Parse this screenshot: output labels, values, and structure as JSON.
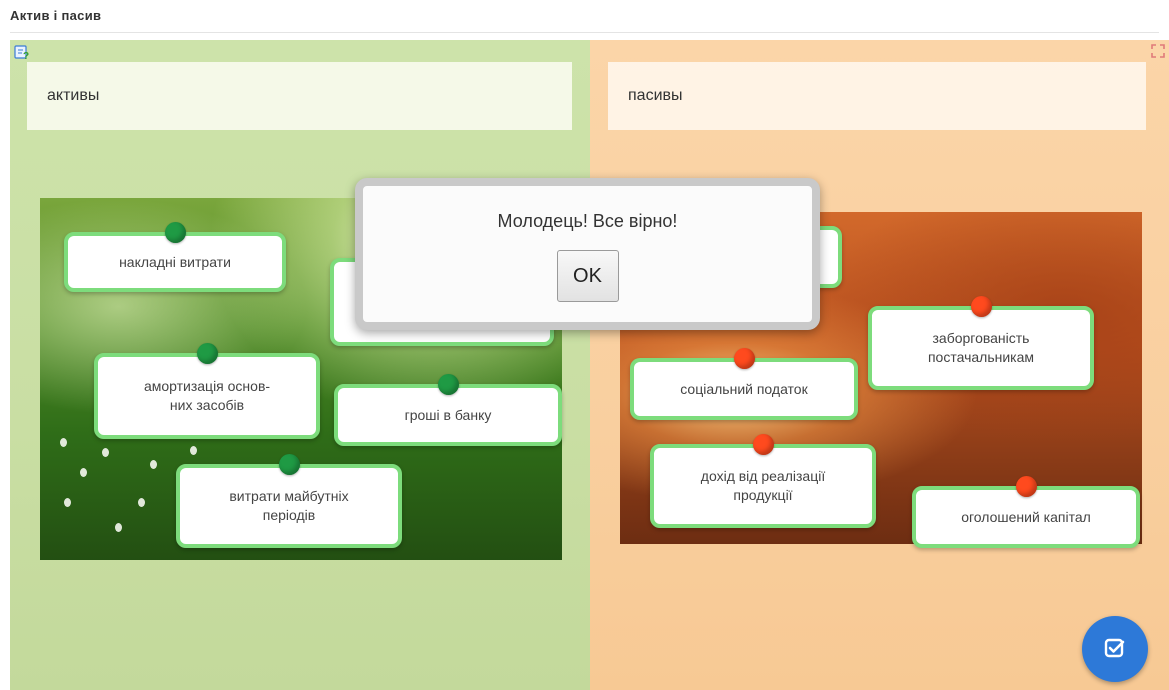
{
  "page": {
    "title": "Актив і пасив"
  },
  "categories": [
    {
      "label": "активы"
    },
    {
      "label": "пасивы"
    }
  ],
  "cards_left": [
    {
      "text": "накладні витрати"
    },
    {
      "text": ""
    },
    {
      "text": "амортизація основ-\nних засобів"
    },
    {
      "text": "гроші в банку"
    },
    {
      "text": "витрати майбутніх\nперіодів"
    }
  ],
  "cards_right": [
    {
      "text": ""
    },
    {
      "text": "заборгованість\nпостачальникам"
    },
    {
      "text": "соціальний податок"
    },
    {
      "text": "дохід від реалізації\nпродукції"
    },
    {
      "text": "оголошений капітал"
    }
  ],
  "dialog": {
    "message": "Молодець! Все вірно!",
    "ok_label": "OK"
  },
  "icons": {
    "help": "help-icon",
    "expand": "expand-icon",
    "check": "check-icon"
  },
  "colors": {
    "assets_bg": "#cde3aa",
    "liabilities_bg": "#fbd5a8",
    "card_border": "#7ddc7c",
    "pin_assets": "#1f9a44",
    "pin_liabilities": "#ff4a1e",
    "check_button": "#2d79d8"
  }
}
